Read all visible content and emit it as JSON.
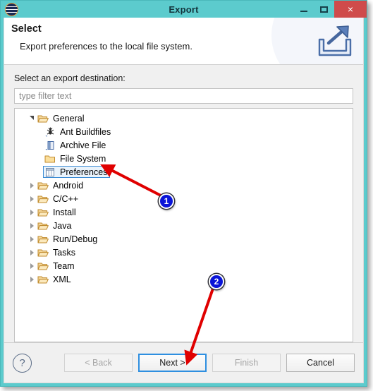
{
  "window": {
    "title": "Export",
    "logo_icon": "eclipse-logo-icon",
    "controls": {
      "minimize_label": "–",
      "maximize_label": "□",
      "close_label": "×"
    }
  },
  "banner": {
    "title": "Select",
    "description": "Export preferences to the local file system.",
    "icon": "export-arrow-tray-icon"
  },
  "content": {
    "destination_label": "Select an export destination:",
    "filter": {
      "value": "",
      "placeholder": "type filter text"
    },
    "tree": [
      {
        "label": "General",
        "level": 0,
        "icon": "folder-open-icon",
        "expander": "expanded",
        "selected": false
      },
      {
        "label": "Ant Buildfiles",
        "level": 1,
        "icon": "ant-buildfile-icon",
        "expander": "none",
        "selected": false
      },
      {
        "label": "Archive File",
        "level": 1,
        "icon": "archive-file-icon",
        "expander": "none",
        "selected": false
      },
      {
        "label": "File System",
        "level": 1,
        "icon": "folder-closed-icon",
        "expander": "none",
        "selected": false
      },
      {
        "label": "Preferences",
        "level": 1,
        "icon": "preferences-icon",
        "expander": "none",
        "selected": true
      },
      {
        "label": "Android",
        "level": 0,
        "icon": "folder-open-icon",
        "expander": "collapsed",
        "selected": false
      },
      {
        "label": "C/C++",
        "level": 0,
        "icon": "folder-open-icon",
        "expander": "collapsed",
        "selected": false
      },
      {
        "label": "Install",
        "level": 0,
        "icon": "folder-open-icon",
        "expander": "collapsed",
        "selected": false
      },
      {
        "label": "Java",
        "level": 0,
        "icon": "folder-open-icon",
        "expander": "collapsed",
        "selected": false
      },
      {
        "label": "Run/Debug",
        "level": 0,
        "icon": "folder-open-icon",
        "expander": "collapsed",
        "selected": false
      },
      {
        "label": "Tasks",
        "level": 0,
        "icon": "folder-open-icon",
        "expander": "collapsed",
        "selected": false
      },
      {
        "label": "Team",
        "level": 0,
        "icon": "folder-open-icon",
        "expander": "collapsed",
        "selected": false
      },
      {
        "label": "XML",
        "level": 0,
        "icon": "folder-open-icon",
        "expander": "collapsed",
        "selected": false
      }
    ]
  },
  "footer": {
    "help_label": "?",
    "buttons": [
      {
        "label": "< Back",
        "state": "disabled"
      },
      {
        "label": "Next >",
        "state": "focused"
      },
      {
        "label": "Finish",
        "state": "disabled"
      },
      {
        "label": "Cancel",
        "state": "normal"
      }
    ]
  },
  "annotations": {
    "badges": [
      {
        "label": "1"
      },
      {
        "label": "2"
      }
    ],
    "arrow_color": "#e00000"
  },
  "colors": {
    "titlebar": "#5ccbcd",
    "close_button": "#cf4b4b",
    "selection_border": "#3c8cd4",
    "badge_fill": "#0a14d8"
  }
}
